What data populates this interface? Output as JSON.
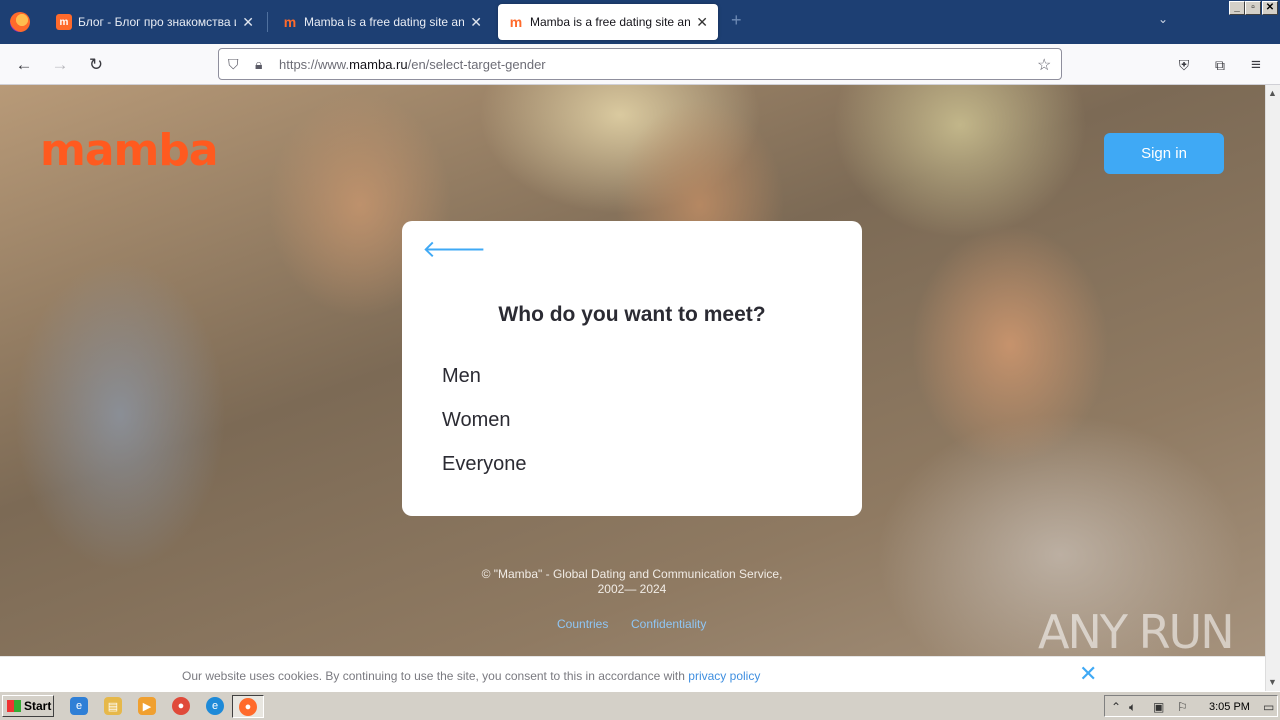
{
  "browser": {
    "tabs": [
      {
        "title": "Блог - Блог про знакомства и отн",
        "favicon": "m",
        "active": false
      },
      {
        "title": "Mamba is a free dating site and a c",
        "favicon": "m",
        "active": false
      },
      {
        "title": "Mamba is a free dating site and a c",
        "favicon": "m",
        "active": true
      }
    ],
    "new_tab": "+",
    "url_prefix": "https://www.",
    "url_domain": "mamba.ru",
    "url_path": "/en/select-target-gender"
  },
  "page": {
    "logo": "mamba",
    "signin_label": "Sign in",
    "modal": {
      "title": "Who do you want to meet?",
      "options": [
        "Men",
        "Women",
        "Everyone"
      ]
    },
    "copyright_line1": "© \"Mamba\" - Global Dating and Communication Service,",
    "copyright_line2": "2002— 2024",
    "footer_links": [
      "Countries",
      "Confidentiality"
    ],
    "watermark": "ANY RUN"
  },
  "cookie_bar": {
    "text": "Our website uses cookies. By continuing to use the site, you consent to this in accordance with",
    "link": "privacy policy"
  },
  "taskbar": {
    "start_label": "Start",
    "clock": "3:05 PM"
  },
  "colors": {
    "brand_orange": "#ff5a1f",
    "accent_blue": "#3fa9f5",
    "tab_strip": "#1d3f73"
  }
}
